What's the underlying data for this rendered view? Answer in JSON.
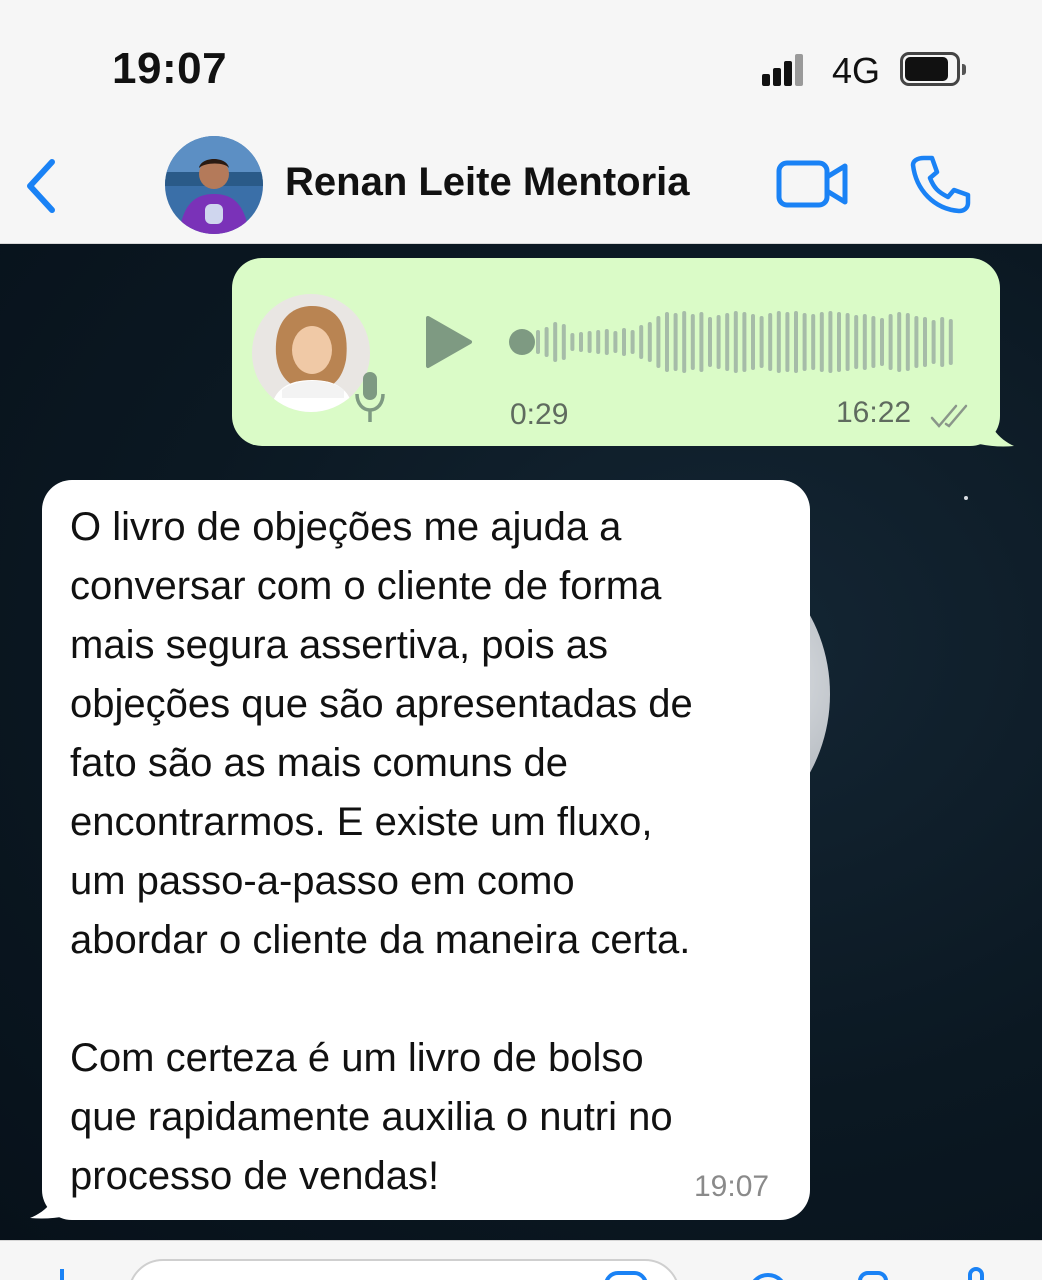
{
  "status_bar": {
    "time": "19:07",
    "network": "4G",
    "signal_bars": 4,
    "battery_level": 0.9
  },
  "header": {
    "contact_name": "Renan Leite Mentoria",
    "back_icon": "chevron-left-icon",
    "video_icon": "video-camera-icon",
    "call_icon": "phone-icon",
    "accent_color": "#1a82f5"
  },
  "messages": [
    {
      "type": "voice",
      "direction": "outgoing",
      "duration": "0:29",
      "time": "16:22",
      "status_icon": "double-check-icon",
      "progress": 0.0,
      "bubble_color": "#dafbc7"
    },
    {
      "type": "text",
      "direction": "incoming",
      "text": "O livro de objeções me ajuda a\nconversar com o cliente de forma\nmais segura assertiva, pois as\nobjeções que são apresentadas de\nfato são as mais comuns de\nencontrarmos. E existe um fluxo,\num passo-a-passo em como\nabordar o cliente da maneira certa.\n\nCom certeza é um livro de bolso\nque rapidamente auxilia o nutri no\nprocesso de vendas!",
      "time": "19:07",
      "bubble_color": "#ffffff"
    }
  ],
  "input_bar": {
    "icons": [
      "plus-icon",
      "sticker-icon",
      "camera-icon",
      "microphone-icon"
    ]
  }
}
